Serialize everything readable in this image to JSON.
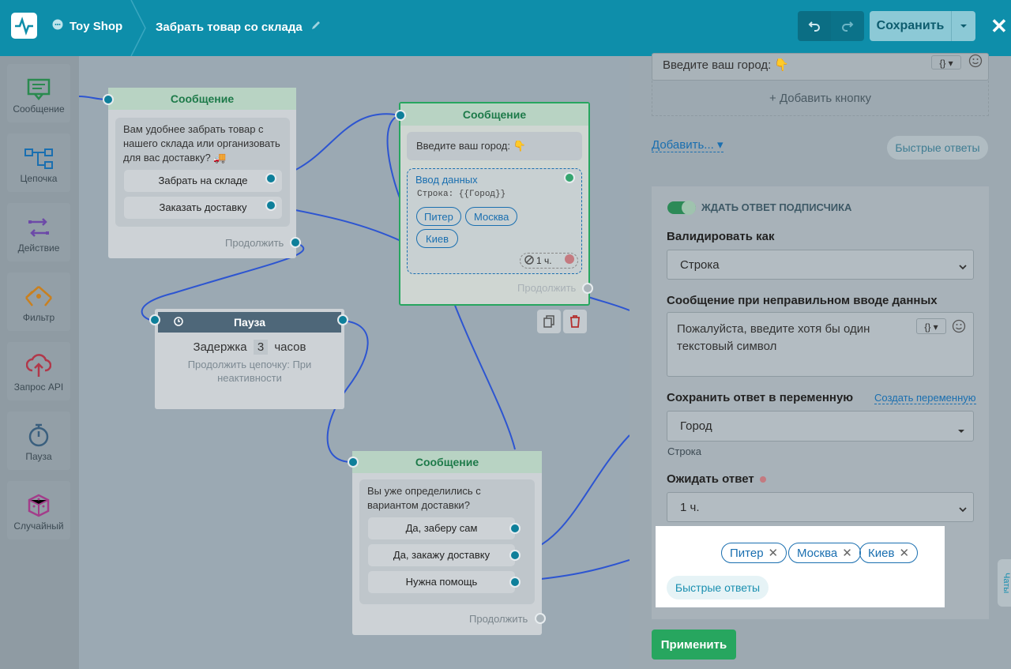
{
  "header": {
    "bot_name": "Toy Shop",
    "flow_title": "Забрать товар со склада",
    "save_label": "Сохранить"
  },
  "sidebar": {
    "items": [
      {
        "label": "Сообщение",
        "icon": "message-icon"
      },
      {
        "label": "Цепочка",
        "icon": "chain-icon"
      },
      {
        "label": "Действие",
        "icon": "action-icon"
      },
      {
        "label": "Фильтр",
        "icon": "filter-icon"
      },
      {
        "label": "Запрос API",
        "icon": "api-icon"
      },
      {
        "label": "Пауза",
        "icon": "timer-icon"
      },
      {
        "label": "Случайный",
        "icon": "dice-icon"
      }
    ]
  },
  "canvas": {
    "node1": {
      "title": "Сообщение",
      "text": "Вам удобнее забрать товар с нашего склада или организовать для вас доставку? 🚚",
      "buttons": [
        "Забрать на складе",
        "Заказать доставку"
      ],
      "continue": "Продолжить"
    },
    "node2": {
      "title": "Сообщение",
      "text": "Введите ваш город: 👇",
      "input_title": "Ввод данных",
      "input_type": "Строка: {{Город}}",
      "chips": [
        "Питер",
        "Москва",
        "Киев"
      ],
      "timer": "1 ч.",
      "continue": "Продолжить"
    },
    "pause": {
      "title": "Пауза",
      "delay_prefix": "Задержка",
      "delay_value": "3",
      "delay_unit": "часов",
      "note": "Продолжить цепочку: При неактивности"
    },
    "node3": {
      "title": "Сообщение",
      "text": "Вы уже определились с вариантом доставки?",
      "buttons": [
        "Да, заберу сам",
        "Да, закажу доставку",
        "Нужна помощь"
      ],
      "continue": "Продолжить"
    }
  },
  "panel": {
    "message_text": "Введите ваш город: 👇",
    "add_button": "+ Добавить кнопку",
    "add_link": "Добавить...",
    "quick_replies_btn": "Быстрые ответы",
    "wait_toggle": "ЖДАТЬ ОТВЕТ ПОДПИСЧИКА",
    "validate_label": "Валидировать как",
    "validate_value": "Строка",
    "error_label": "Сообщение при неправильном вводе данных",
    "error_text": "Пожалуйста, введите хотя бы один текстовый символ",
    "save_var_label": "Сохранить ответ в переменную",
    "create_var_link": "Создать переменную",
    "var_value": "Город",
    "var_type": "Строка",
    "wait_label": "Ожидать ответ",
    "wait_value": "1 ч.",
    "tags": [
      "Питер",
      "Москва",
      "Киев"
    ],
    "quick_replies_label": "Быстрые ответы",
    "apply_label": "Применить",
    "chats_tab": "Чаты"
  },
  "colors": {
    "header": "#0e8eaa",
    "accent": "#1a6fb0",
    "apply": "#27a65f",
    "node_header": "#1d7a49"
  }
}
